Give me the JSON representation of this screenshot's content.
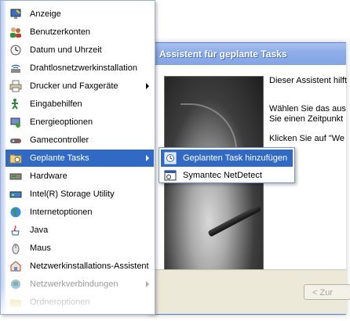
{
  "wizard": {
    "title": "Assistent für geplante Tasks",
    "text1": "Dieser Assistent hilft",
    "text2": "Wählen Sie das aus",
    "text3": "Sie einen Zeitpunkt",
    "text4": "Klicken Sie auf \"We",
    "back_label": "< Zur"
  },
  "menu": {
    "items": [
      {
        "label": "Anzeige",
        "icon": "display-icon"
      },
      {
        "label": "Benutzerkonten",
        "icon": "users-icon"
      },
      {
        "label": "Datum und Uhrzeit",
        "icon": "clock-icon"
      },
      {
        "label": "Drahtlosnetzwerkinstallation",
        "icon": "wireless-icon"
      },
      {
        "label": "Drucker und Faxgeräte",
        "icon": "printer-icon"
      },
      {
        "label": "Eingabehilfen",
        "icon": "accessibility-icon"
      },
      {
        "label": "Energieoptionen",
        "icon": "power-icon"
      },
      {
        "label": "Gamecontroller",
        "icon": "gamecontroller-icon"
      },
      {
        "label": "Geplante Tasks",
        "icon": "scheduled-tasks-icon"
      },
      {
        "label": "Hardware",
        "icon": "hardware-icon"
      },
      {
        "label": "Intel(R) Storage Utility",
        "icon": "storage-icon"
      },
      {
        "label": "Internetoptionen",
        "icon": "globe-icon"
      },
      {
        "label": "Java",
        "icon": "java-icon"
      },
      {
        "label": "Maus",
        "icon": "mouse-icon"
      },
      {
        "label": "Netzwerkinstallations-Assistent",
        "icon": "network-setup-icon"
      },
      {
        "label": "Netzwerkverbindungen",
        "icon": "network-connections-icon"
      },
      {
        "label": "Ordneroptionen",
        "icon": "folder-options-icon"
      }
    ]
  },
  "submenu": {
    "items": [
      {
        "label": "Geplanten Task hinzufügen",
        "icon": "add-task-icon"
      },
      {
        "label": "Symantec NetDetect",
        "icon": "task-window-icon"
      }
    ]
  },
  "colors": {
    "selection": "#316ac5",
    "titlebar": "#8eaee8",
    "menu_border": "#9ab0d6"
  }
}
